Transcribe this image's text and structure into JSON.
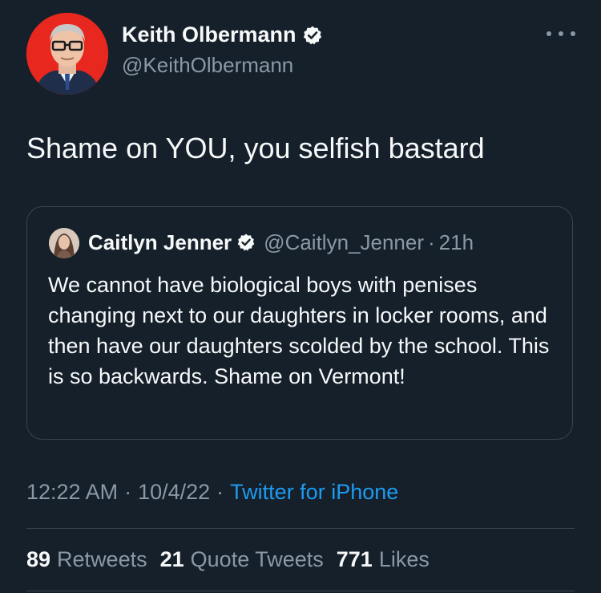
{
  "author": {
    "name": "Keith Olbermann",
    "handle": "@KeithOlbermann",
    "avatar_bg": "#e8281e",
    "verified_icon": "verified-badge-icon"
  },
  "tweet": {
    "text": "Shame on YOU, you selfish bastard"
  },
  "quote": {
    "name": "Caitlyn Jenner",
    "handle": "@Caitlyn_Jenner",
    "separator": "·",
    "time": "21h",
    "text": "We cannot have biological boys with penises changing next to our daughters in locker rooms, and then have our daughters scolded by the school. This is so backwards. Shame on Vermont!"
  },
  "meta": {
    "time": "12:22 AM",
    "separator": "·",
    "date": "10/4/22",
    "source": "Twitter for iPhone"
  },
  "stats": {
    "retweets_count": "89",
    "retweets_label": "Retweets",
    "quotes_count": "21",
    "quotes_label": "Quote Tweets",
    "likes_count": "771",
    "likes_label": "Likes"
  },
  "colors": {
    "background": "#15202b",
    "text": "#f7f9f9",
    "secondary": "#8b98a5",
    "accent": "#1d9bf0",
    "border": "#38444d"
  }
}
